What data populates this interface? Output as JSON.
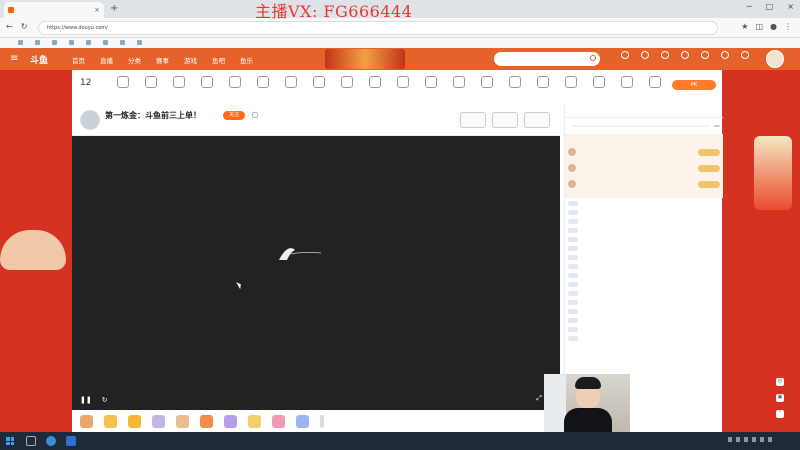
{
  "overlay": {
    "text": "主播VX:   FG666444"
  },
  "browser": {
    "tab_title": "",
    "url": "https://www.douyu.com/",
    "bookmarks": [
      "",
      "",
      "",
      "",
      "",
      "",
      "",
      ""
    ]
  },
  "site": {
    "logo": "斗鱼",
    "nav": [
      "首页",
      "直播",
      "分类",
      "赛事",
      "游戏",
      "鱼吧",
      "鱼乐"
    ],
    "promo_top": "",
    "promo_sub": "",
    "banner": "",
    "search_placeholder": "",
    "header_icons": [
      "",
      "",
      "",
      "",
      "",
      "",
      ""
    ]
  },
  "categories": {
    "count": "12",
    "count_label": "",
    "items": [
      "",
      "",
      "",
      "",
      "",
      "",
      "",
      "",
      "",
      "",
      "",
      "",
      "",
      "",
      "",
      "",
      "",
      "",
      "",
      "",
      ""
    ],
    "pk_label": "PK",
    "pk_sub": ""
  },
  "stream": {
    "title": "第一炼金：斗鱼前三上单！",
    "heat": "",
    "follow_label": "关注",
    "level": "",
    "streamer_name": "",
    "fans": "",
    "category": "",
    "tag": "",
    "btn_report": "",
    "btn_share": "",
    "btn_download": "",
    "player_message": ""
  },
  "chat": {
    "tabs": [
      "",
      "",
      "",
      ""
    ],
    "sub_left": "",
    "sub_msg": "",
    "sub_right": "",
    "noble_title": "",
    "noble_title_right": "",
    "noble": [
      {
        "name": "",
        "badge": ""
      },
      {
        "name": "",
        "badge": ""
      },
      {
        "name": "",
        "badge": ""
      }
    ],
    "messages": [
      {
        "user": "",
        "text": "",
        "style": "normal"
      },
      {
        "user": "",
        "text": "",
        "style": "normal"
      },
      {
        "user": "",
        "text": "",
        "style": "red"
      },
      {
        "user": "",
        "text": "",
        "style": "red"
      },
      {
        "user": "",
        "text": "",
        "style": "red"
      },
      {
        "user": "",
        "text": "",
        "style": "red"
      },
      {
        "user": "",
        "text": "",
        "style": "normal"
      },
      {
        "user": "",
        "text": "",
        "style": "normal"
      },
      {
        "user": "",
        "text": "",
        "style": "normal"
      },
      {
        "user": "",
        "text": "",
        "style": "normal"
      },
      {
        "user": "",
        "text": "",
        "style": "normal"
      },
      {
        "user": "",
        "text": "",
        "style": "normal"
      },
      {
        "user": "",
        "text": "",
        "style": "normal"
      },
      {
        "user": "",
        "text": "",
        "style": "normal"
      },
      {
        "user": "",
        "text": "",
        "style": "normal"
      },
      {
        "user": "",
        "text": "",
        "style": "normal"
      }
    ]
  },
  "side_promo": {
    "text": ""
  },
  "taskbar": {
    "time": "",
    "date": ""
  },
  "colors": {
    "brand": "#e5632a",
    "background": "#d53221",
    "overlay_text": "#e8372f"
  }
}
